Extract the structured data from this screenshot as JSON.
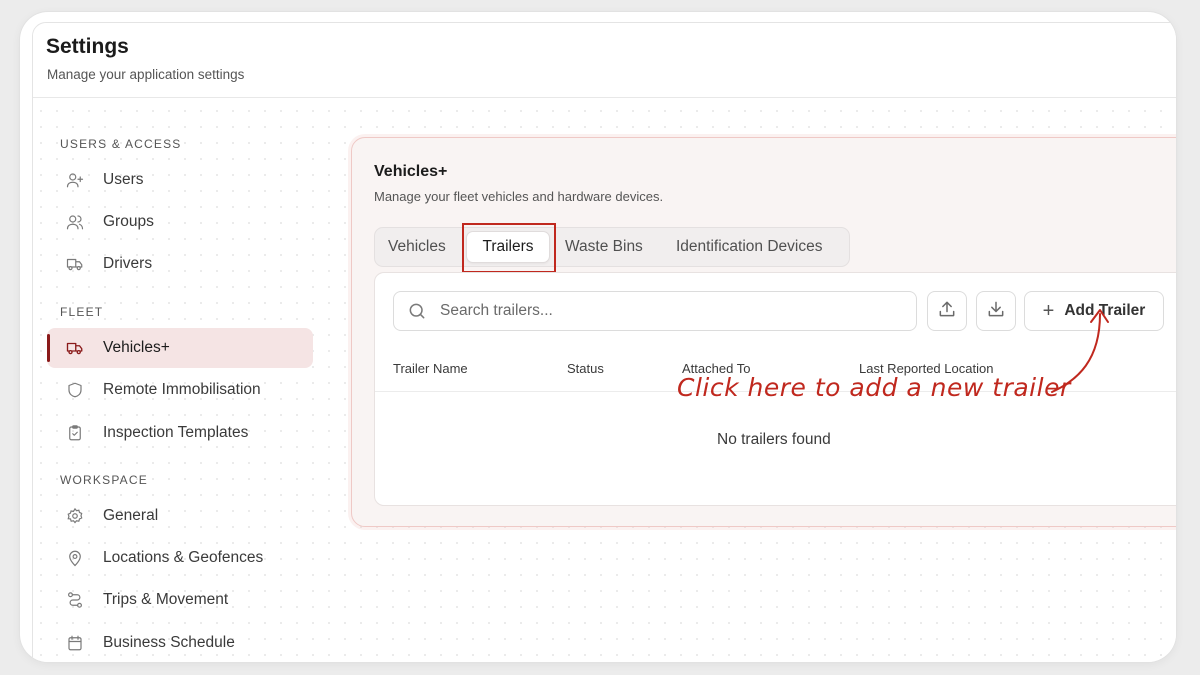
{
  "header": {
    "title": "Settings",
    "subtitle": "Manage your application settings"
  },
  "sidebar": {
    "sections": [
      {
        "title": "USERS & ACCESS"
      },
      {
        "title": "FLEET"
      },
      {
        "title": "WORKSPACE"
      }
    ],
    "items": [
      {
        "label": "Users",
        "icon": "user-plus-icon"
      },
      {
        "label": "Groups",
        "icon": "users-icon"
      },
      {
        "label": "Drivers",
        "icon": "truck-icon"
      },
      {
        "label": "Vehicles+",
        "icon": "truck-icon",
        "active": true
      },
      {
        "label": "Remote Immobilisation",
        "icon": "shield-icon"
      },
      {
        "label": "Inspection Templates",
        "icon": "clipboard-check-icon"
      },
      {
        "label": "General",
        "icon": "gear-icon"
      },
      {
        "label": "Locations & Geofences",
        "icon": "map-pin-icon"
      },
      {
        "label": "Trips & Movement",
        "icon": "route-icon"
      },
      {
        "label": "Business Schedule",
        "icon": "calendar-icon"
      }
    ]
  },
  "panel": {
    "title": "Vehicles+",
    "subtitle": "Manage your fleet vehicles and hardware devices.",
    "tabs": [
      {
        "label": "Vehicles"
      },
      {
        "label": "Trailers",
        "active": true
      },
      {
        "label": "Waste Bins"
      },
      {
        "label": "Identification Devices"
      }
    ],
    "search": {
      "placeholder": "Search trailers..."
    },
    "add_button": {
      "label": "Add Trailer"
    },
    "table": {
      "columns": [
        "Trailer Name",
        "Status",
        "Attached To",
        "Last Reported Location"
      ],
      "empty_text": "No trailers found"
    }
  },
  "annotation": {
    "text": "Click here to add a new trailer",
    "color": "#c0281e"
  },
  "colors": {
    "accent": "#8a1a1a",
    "active_bg": "#f5e4e4",
    "panel_border": "#efc9c6"
  }
}
